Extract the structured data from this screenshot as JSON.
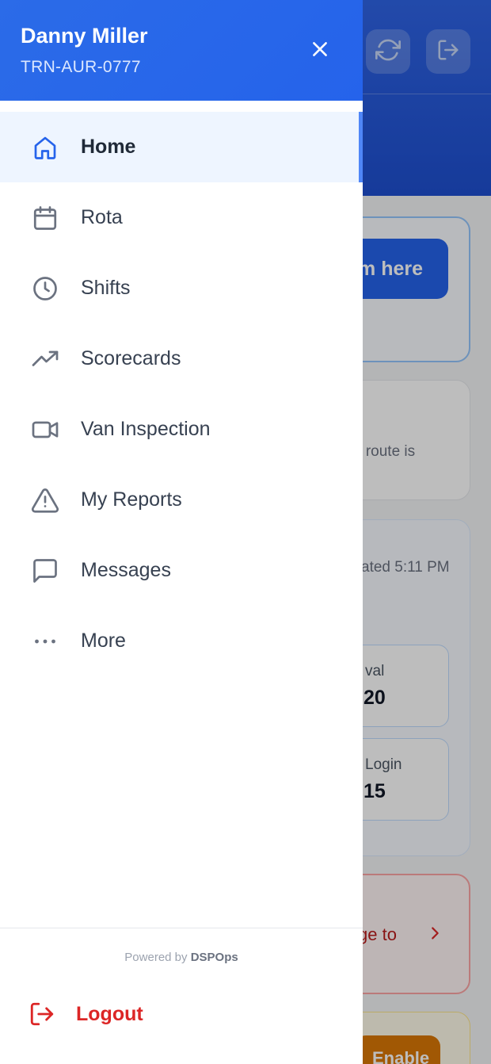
{
  "background": {
    "header_buttons": [
      {
        "icon": "refresh-icon"
      },
      {
        "icon": "sign-out-icon"
      }
    ],
    "primary_button_text": "m here",
    "route_text": "ir route is",
    "updated_text": "ated 5:11 PM",
    "stats": [
      {
        "label": "val",
        "value": "20"
      },
      {
        "label": "Login",
        "value": "15"
      }
    ],
    "alert_text": "ge to",
    "enable_label": "Enable"
  },
  "drawer": {
    "user_name": "Danny Miller",
    "user_id": "TRN-AUR-0777",
    "menu": [
      {
        "label": "Home",
        "icon": "home-icon",
        "active": true
      },
      {
        "label": "Rota",
        "icon": "calendar-icon",
        "active": false
      },
      {
        "label": "Shifts",
        "icon": "clock-icon",
        "active": false
      },
      {
        "label": "Scorecards",
        "icon": "trending-up-icon",
        "active": false
      },
      {
        "label": "Van Inspection",
        "icon": "video-camera-icon",
        "active": false
      },
      {
        "label": "My Reports",
        "icon": "warning-triangle-icon",
        "active": false
      },
      {
        "label": "Messages",
        "icon": "message-square-icon",
        "active": false
      },
      {
        "label": "More",
        "icon": "more-horizontal-icon",
        "active": false
      }
    ],
    "powered_prefix": "Powered by",
    "powered_brand": "DSPOps",
    "logout_label": "Logout"
  },
  "colors": {
    "accent": "#2563eb",
    "active_bg": "#eef5ff",
    "logout": "#dc2626",
    "text": "#374151"
  }
}
